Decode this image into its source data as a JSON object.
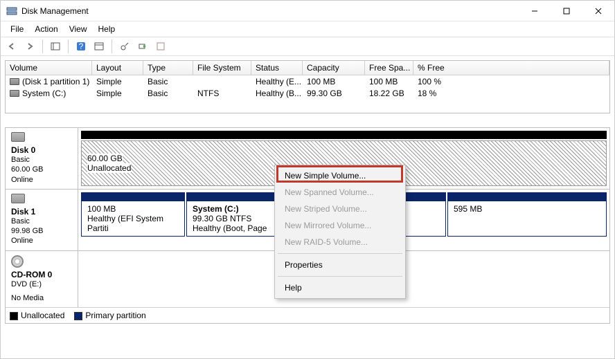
{
  "window": {
    "title": "Disk Management"
  },
  "menu": {
    "file": "File",
    "action": "Action",
    "view": "View",
    "help": "Help"
  },
  "columns": {
    "volume": "Volume",
    "layout": "Layout",
    "type": "Type",
    "fs": "File System",
    "status": "Status",
    "capacity": "Capacity",
    "free": "Free Spa...",
    "pct": "% Free"
  },
  "volumes": [
    {
      "name": "(Disk 1 partition 1)",
      "layout": "Simple",
      "type": "Basic",
      "fs": "",
      "status": "Healthy (E...",
      "capacity": "100 MB",
      "free": "100 MB",
      "pct": "100 %"
    },
    {
      "name": "System (C:)",
      "layout": "Simple",
      "type": "Basic",
      "fs": "NTFS",
      "status": "Healthy (B...",
      "capacity": "99.30 GB",
      "free": "18.22 GB",
      "pct": "18 %"
    }
  ],
  "disks": {
    "d0": {
      "title": "Disk 0",
      "type": "Basic",
      "size": "60.00 GB",
      "status": "Online",
      "part_size": "60.00 GB",
      "part_status": "Unallocated"
    },
    "d1": {
      "title": "Disk 1",
      "type": "Basic",
      "size": "99.98 GB",
      "status": "Online",
      "p1_size": "100 MB",
      "p1_status": "Healthy (EFI System Partiti",
      "p2_title": "System  (C:)",
      "p2_size": "99.30 GB NTFS",
      "p2_status": "Healthy (Boot, Page",
      "p3_size": "595 MB"
    },
    "cd": {
      "title": "CD-ROM 0",
      "drive": "DVD (E:)",
      "status": "No Media"
    }
  },
  "legend": {
    "un": "Unallocated",
    "pp": "Primary partition"
  },
  "ctx": {
    "simple": "New Simple Volume...",
    "spanned": "New Spanned Volume...",
    "striped": "New Striped Volume...",
    "mirrored": "New Mirrored Volume...",
    "raid": "New RAID-5 Volume...",
    "props": "Properties",
    "help": "Help"
  }
}
